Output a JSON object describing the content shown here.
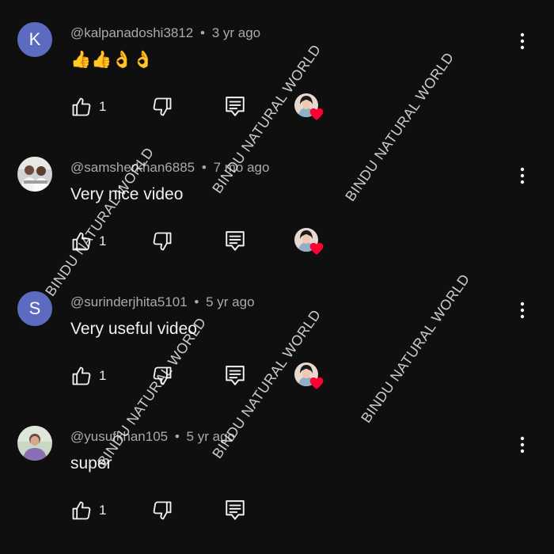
{
  "comments": [
    {
      "avatar_letter": "K",
      "handle": "@kalpanadoshi3812",
      "separator": "•",
      "time": "3 yr ago",
      "text": "👍👍👌👌",
      "likes": "1"
    },
    {
      "avatar_letter": "",
      "handle": "@samsherkhan6885",
      "separator": "•",
      "time": "7 mo ago",
      "text": "Very nice video",
      "likes": "1"
    },
    {
      "avatar_letter": "S",
      "handle": "@surinderjhita5101",
      "separator": "•",
      "time": "5 yr ago",
      "text": "Very useful video",
      "likes": "1"
    },
    {
      "avatar_letter": "",
      "handle": "@yusufkhan105",
      "separator": "•",
      "time": "5 yr ago",
      "text": "super",
      "likes": "1"
    }
  ],
  "watermark": "BINDU NATURAL WORLD",
  "colors": {
    "background": "#0f0f0f",
    "avatar_letter_bg": "#5c6bc0",
    "heart": "#ff0033",
    "meta_text": "#aaaaaa"
  },
  "icons": [
    "thumbs-up-icon",
    "thumbs-down-icon",
    "reply-icon",
    "more-vert-icon",
    "creator-heart-icon"
  ]
}
